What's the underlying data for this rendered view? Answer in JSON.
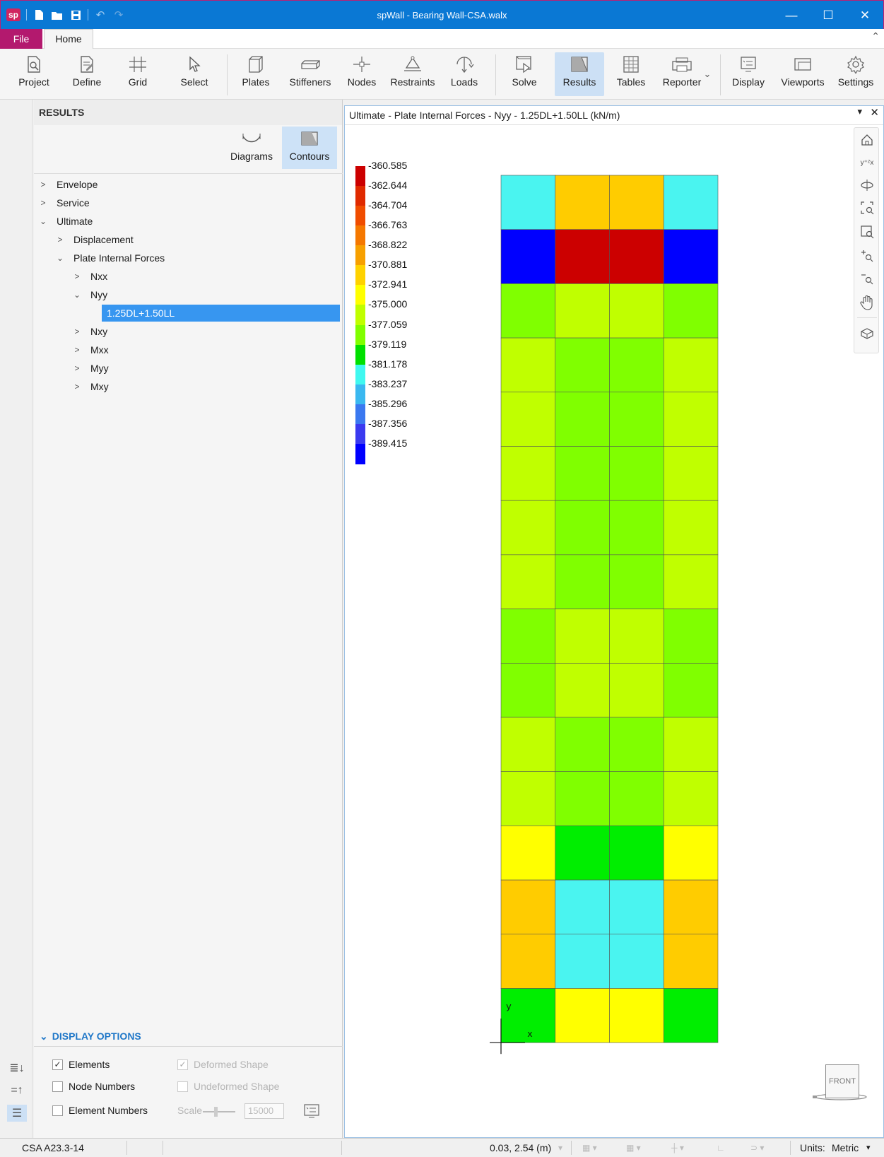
{
  "window": {
    "title": "spWall - Bearing Wall-CSA.walx",
    "logo": "sp",
    "minimize": "—",
    "maximize": "☐",
    "close": "✕"
  },
  "tabs": {
    "file": "File",
    "home": "Home"
  },
  "ribbon": {
    "buttons": [
      {
        "label": "Project",
        "icon": "project-icon"
      },
      {
        "label": "Define",
        "icon": "define-icon"
      },
      {
        "label": "Grid",
        "icon": "grid-icon"
      },
      {
        "label": "Select",
        "icon": "select-cursor-icon"
      },
      {
        "label": "Plates",
        "icon": "plates-icon"
      },
      {
        "label": "Stiffeners",
        "icon": "stiffeners-icon"
      },
      {
        "label": "Nodes",
        "icon": "nodes-icon"
      },
      {
        "label": "Restraints",
        "icon": "restraints-icon"
      },
      {
        "label": "Loads",
        "icon": "loads-icon"
      },
      {
        "label": "Solve",
        "icon": "solve-icon"
      },
      {
        "label": "Results",
        "icon": "results-icon",
        "active": true
      },
      {
        "label": "Tables",
        "icon": "tables-icon"
      },
      {
        "label": "Reporter",
        "icon": "reporter-icon"
      },
      {
        "label": "Display",
        "icon": "display-icon"
      },
      {
        "label": "Viewports",
        "icon": "viewports-icon"
      },
      {
        "label": "Settings",
        "icon": "gear-icon"
      }
    ]
  },
  "panel": {
    "title": "RESULTS",
    "view_modes": [
      {
        "label": "Diagrams",
        "active": false
      },
      {
        "label": "Contours",
        "active": true
      }
    ],
    "tree": [
      {
        "label": "Envelope",
        "level": 0,
        "expanded": false
      },
      {
        "label": "Service",
        "level": 0,
        "expanded": false
      },
      {
        "label": "Ultimate",
        "level": 0,
        "expanded": true
      },
      {
        "label": "Displacement",
        "level": 1,
        "expanded": false
      },
      {
        "label": "Plate Internal Forces",
        "level": 1,
        "expanded": true
      },
      {
        "label": "Nxx",
        "level": 2,
        "expanded": false
      },
      {
        "label": "Nyy",
        "level": 2,
        "expanded": true
      },
      {
        "label": "1.25DL+1.50LL",
        "level": 3,
        "selected": true
      },
      {
        "label": "Nxy",
        "level": 2,
        "expanded": false
      },
      {
        "label": "Mxx",
        "level": 2,
        "expanded": false
      },
      {
        "label": "Myy",
        "level": 2,
        "expanded": false
      },
      {
        "label": "Mxy",
        "level": 2,
        "expanded": false
      }
    ],
    "display_options": {
      "title": "DISPLAY OPTIONS",
      "elements": {
        "label": "Elements",
        "checked": true
      },
      "node_numbers": {
        "label": "Node Numbers",
        "checked": false
      },
      "element_numbers": {
        "label": "Element Numbers",
        "checked": false
      },
      "deformed_shape": {
        "label": "Deformed Shape",
        "checked": true,
        "disabled": true
      },
      "undeformed_shape": {
        "label": "Undeformed Shape",
        "checked": false,
        "disabled": true
      },
      "scale_label": "Scale",
      "scale_value": "15000"
    }
  },
  "viewport": {
    "title": "Ultimate - Plate Internal Forces - Nyy - 1.25DL+1.50LL (kN/m)",
    "legend": {
      "labels": [
        "-360.585",
        "-362.644",
        "-364.704",
        "-366.763",
        "-368.822",
        "-370.881",
        "-372.941",
        "-375.000",
        "-377.059",
        "-379.119",
        "-381.178",
        "-383.237",
        "-385.296",
        "-387.356",
        "-389.415"
      ],
      "colors": [
        "#cc0000",
        "#e02a00",
        "#f04d00",
        "#f57800",
        "#f7a000",
        "#ffd200",
        "#ffff00",
        "#c0ff00",
        "#80ff00",
        "#00e000",
        "#40f8f0",
        "#3ab8f0",
        "#3a78f0",
        "#3a3af0",
        "#0000ff"
      ]
    },
    "mesh": {
      "rows": 16,
      "cols": 4,
      "cell_colors": [
        [
          "#4af4f0",
          "#ffcc00",
          "#ffcc00",
          "#4af4f0"
        ],
        [
          "#0000ff",
          "#cc0000",
          "#cc0000",
          "#0000ff"
        ],
        [
          "#80ff00",
          "#c0ff00",
          "#c0ff00",
          "#80ff00"
        ],
        [
          "#c0ff00",
          "#80ff00",
          "#80ff00",
          "#c0ff00"
        ],
        [
          "#c0ff00",
          "#80ff00",
          "#80ff00",
          "#c0ff00"
        ],
        [
          "#c0ff00",
          "#80ff00",
          "#80ff00",
          "#c0ff00"
        ],
        [
          "#c0ff00",
          "#80ff00",
          "#80ff00",
          "#c0ff00"
        ],
        [
          "#c0ff00",
          "#80ff00",
          "#80ff00",
          "#c0ff00"
        ],
        [
          "#80ff00",
          "#c0ff00",
          "#c0ff00",
          "#80ff00"
        ],
        [
          "#80ff00",
          "#c0ff00",
          "#c0ff00",
          "#80ff00"
        ],
        [
          "#c0ff00",
          "#80ff00",
          "#80ff00",
          "#c0ff00"
        ],
        [
          "#c0ff00",
          "#80ff00",
          "#80ff00",
          "#c0ff00"
        ],
        [
          "#ffff00",
          "#00ee00",
          "#00ee00",
          "#ffff00"
        ],
        [
          "#ffcc00",
          "#4af4f0",
          "#4af4f0",
          "#ffcc00"
        ],
        [
          "#ffcc00",
          "#4af4f0",
          "#4af4f0",
          "#ffcc00"
        ],
        [
          "#00ee00",
          "#ffff00",
          "#ffff00",
          "#00ee00"
        ]
      ]
    },
    "axis_y": "y",
    "axis_x": "x",
    "view_cube": "FRONT"
  },
  "statusbar": {
    "code": "CSA A23.3-14",
    "coords": "0.03, 2.54 (m)",
    "units_label": "Units:",
    "units_value": "Metric"
  }
}
